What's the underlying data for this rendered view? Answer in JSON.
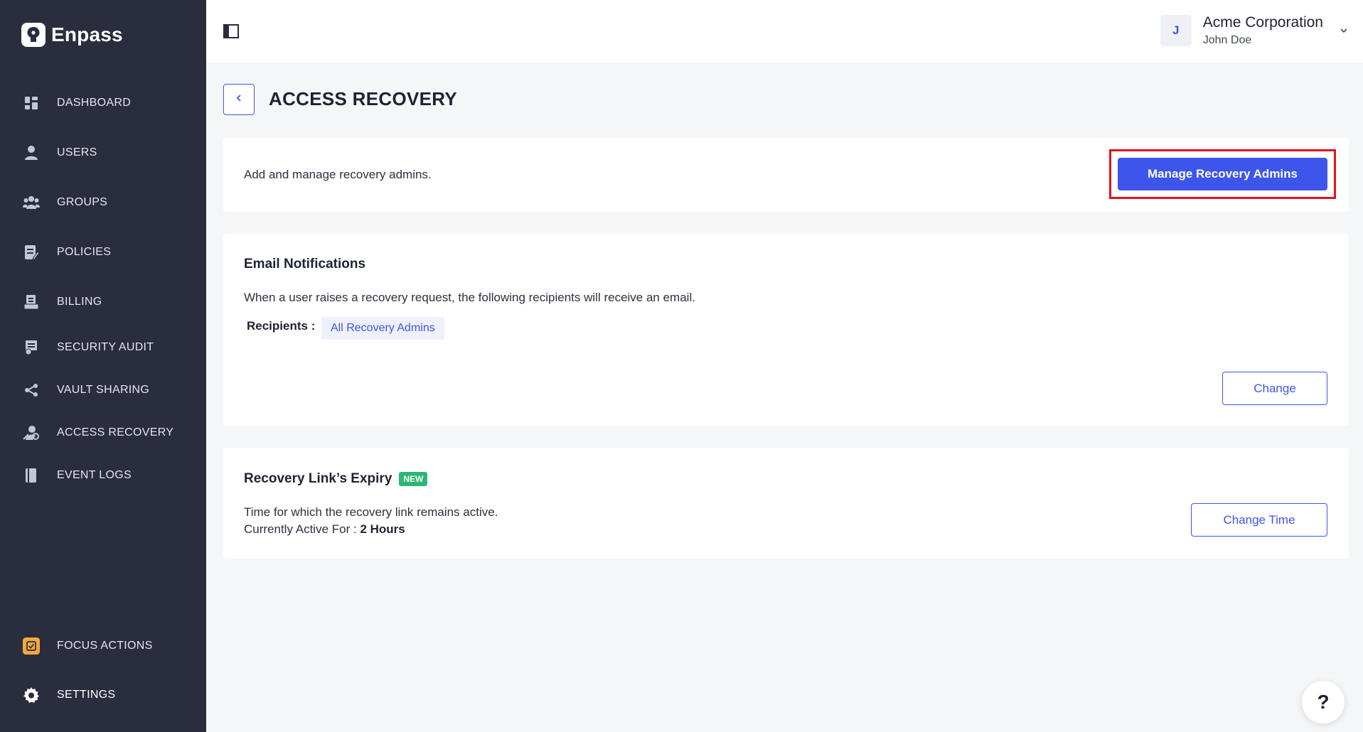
{
  "brand": {
    "name": "Enpass"
  },
  "sidebar": {
    "items": [
      {
        "label": "DASHBOARD",
        "icon": "dashboard-icon"
      },
      {
        "label": "USERS",
        "icon": "user-icon"
      },
      {
        "label": "GROUPS",
        "icon": "groups-icon"
      },
      {
        "label": "POLICIES",
        "icon": "policies-icon"
      },
      {
        "label": "BILLING",
        "icon": "billing-icon"
      },
      {
        "label": "SECURITY AUDIT",
        "icon": "security-audit-icon"
      },
      {
        "label": "VAULT SHARING",
        "icon": "share-icon"
      },
      {
        "label": "ACCESS RECOVERY",
        "icon": "access-recovery-icon"
      },
      {
        "label": "EVENT LOGS",
        "icon": "event-logs-icon"
      }
    ],
    "bottom": [
      {
        "label": "FOCUS ACTIONS",
        "icon": "focus-actions-icon"
      },
      {
        "label": "SETTINGS",
        "icon": "gear-icon"
      }
    ]
  },
  "header": {
    "avatar_initial": "J",
    "org_name": "Acme Corporation",
    "user_name": "John Doe"
  },
  "page": {
    "title": "ACCESS RECOVERY"
  },
  "recovery_admins": {
    "description": "Add and manage recovery admins.",
    "button_label": "Manage Recovery Admins"
  },
  "email_notifications": {
    "title": "Email Notifications",
    "description": "When a user raises a recovery request, the following recipients will receive an email.",
    "recipients_label": "Recipients :",
    "recipients_value": "All Recovery Admins",
    "button_label": "Change"
  },
  "link_expiry": {
    "title": "Recovery Link’s Expiry",
    "badge": "NEW",
    "description": "Time for which the recovery link remains active.",
    "active_prefix": "Currently Active For :",
    "active_value": "2 Hours",
    "button_label": "Change Time"
  },
  "help": {
    "label": "?"
  },
  "colors": {
    "sidebar_bg": "#2a2d3e",
    "accent": "#3d55ea",
    "highlight_border": "#e0141e",
    "badge_green": "#2bb673"
  }
}
